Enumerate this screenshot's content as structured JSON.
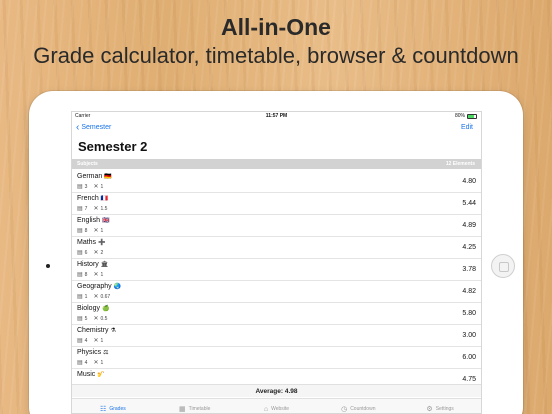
{
  "banner": {
    "title": "All-in-One",
    "subtitle": "Grade calculator, timetable, browser & countdown"
  },
  "status": {
    "carrier": "Carrier",
    "time": "11:57 PM",
    "battery": "80%",
    "battery_level": 0.8
  },
  "nav": {
    "back_label": "Semester",
    "edit_label": "Edit",
    "title": "Semester 2"
  },
  "section": {
    "left": "Subjects",
    "right": "12 Elements"
  },
  "subjects": [
    {
      "name": "German",
      "flag": "🇩🇪",
      "count": "3",
      "weight": "1",
      "grade": "4.80"
    },
    {
      "name": "French",
      "flag": "🇫🇷",
      "count": "7",
      "weight": "1.5",
      "grade": "5.44"
    },
    {
      "name": "English",
      "flag": "🇬🇧",
      "count": "8",
      "weight": "1",
      "grade": "4.89"
    },
    {
      "name": "Maths",
      "flag": "➕",
      "count": "6",
      "weight": "2",
      "grade": "4.25"
    },
    {
      "name": "History",
      "flag": "🏛",
      "count": "8",
      "weight": "1",
      "grade": "3.78"
    },
    {
      "name": "Geography",
      "flag": "🌏",
      "count": "1",
      "weight": "0.67",
      "grade": "4.82"
    },
    {
      "name": "Biology",
      "flag": "🍏",
      "count": "5",
      "weight": "0.5",
      "grade": "5.80"
    },
    {
      "name": "Chemistry",
      "flag": "⚗",
      "count": "4",
      "weight": "1",
      "grade": "3.00"
    },
    {
      "name": "Physics",
      "flag": "⚖",
      "count": "4",
      "weight": "1",
      "grade": "6.00"
    },
    {
      "name": "Music",
      "flag": "🎷",
      "count": "",
      "weight": "",
      "grade": "4.75"
    }
  ],
  "average": "Average: 4.98",
  "tabs": [
    {
      "label": "Grades",
      "icon": "☷",
      "active": true
    },
    {
      "label": "Timetable",
      "icon": "▦",
      "active": false
    },
    {
      "label": "Website",
      "icon": "⌂",
      "active": false
    },
    {
      "label": "Countdown",
      "icon": "◷",
      "active": false
    },
    {
      "label": "Settings",
      "icon": "⚙",
      "active": false
    }
  ],
  "colors": {
    "accent": "#1a73e8",
    "wood": "#e3b47a"
  }
}
